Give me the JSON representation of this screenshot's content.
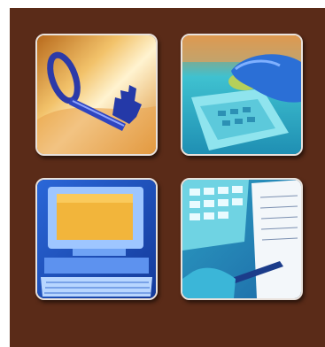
{
  "icons": [
    {
      "name": "key-icon",
      "colors": {
        "bg": "#e8a24a",
        "fg": "#2d3fb8"
      }
    },
    {
      "name": "cash-register-hand-icon",
      "colors": {
        "bg": "#2bb7c9",
        "fg": "#2b6fd6"
      }
    },
    {
      "name": "desktop-computer-icon",
      "colors": {
        "bg": "#1e5fc9",
        "fg": "#f0b43a"
      }
    },
    {
      "name": "calculator-pen-document-icon",
      "colors": {
        "bg": "#2aa7c4",
        "fg": "#f4f4f4"
      }
    }
  ],
  "colors": {
    "panel": "#5a2b18",
    "border": "#e9e2dc"
  }
}
